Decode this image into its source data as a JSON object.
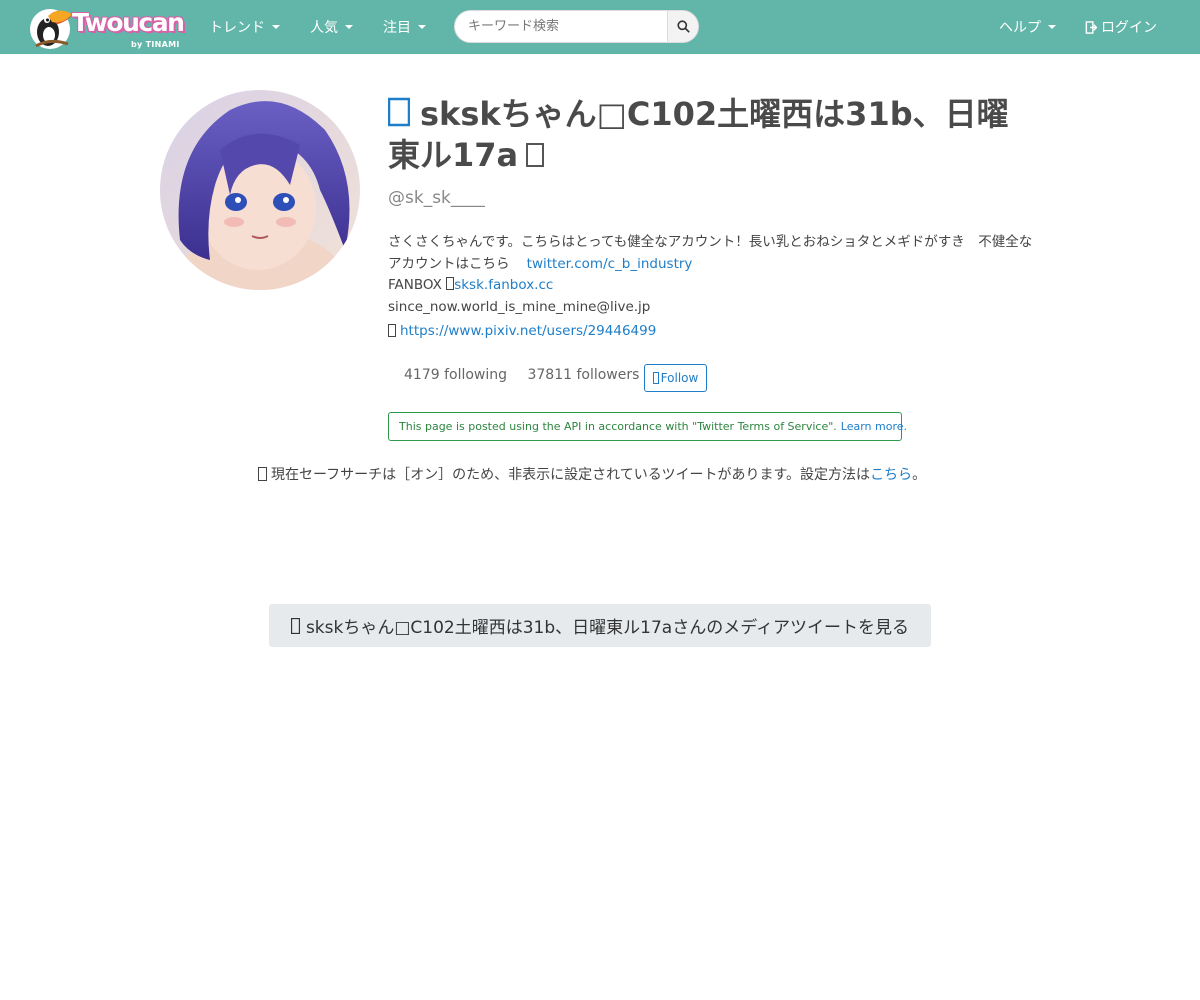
{
  "navbar": {
    "logo_text": "Twoucan",
    "logo_byline": "by TINAMI",
    "menus": [
      {
        "label": "トレンド"
      },
      {
        "label": "人気"
      },
      {
        "label": "注目"
      }
    ],
    "search": {
      "placeholder": "キーワード検索",
      "value": ""
    },
    "help_label": "ヘルプ",
    "login_label": "ログイン",
    "background_color": "#62b6a9"
  },
  "profile": {
    "name": "skskちゃん□C102土曜西は31b、日曜東ル17a",
    "screen_name": "@sk_sk____",
    "bio_line1": "さくさくちゃんです。こちらはとっても健全なアカウント！長い乳とおねショタとメギドがすき　不健全なアカウントはこちら",
    "bio_link1": "twitter.com/c_b_industry",
    "fanbox_label": "FANBOX",
    "fanbox_link": "sksk.fanbox.cc",
    "email": "since_now.world_is_mine_mine@live.jp",
    "url": "https://www.pixiv.net/users/29446499",
    "following": "4179 following",
    "followers": "37811 followers",
    "follow_label": "Follow",
    "accent_color": "#1f7ec7"
  },
  "notice": {
    "text": "This page is posted using the API in accordance with \"Twitter Terms of Service\".",
    "link": "Learn more."
  },
  "safe_search": {
    "text": "現在セーフサーチは［オン］のため、非表示に設定されているツイートがあります。設定方法は",
    "link": "こちら",
    "suffix": "。"
  },
  "media_button": {
    "label": "skskちゃん□C102土曜西は31b、日曜東ル17aさんのメディアツイートを見る"
  }
}
